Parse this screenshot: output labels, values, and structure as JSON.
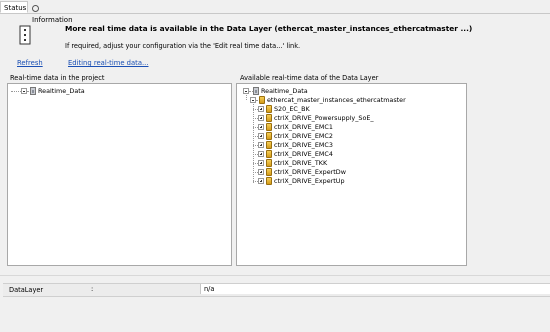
{
  "tabs": [
    {
      "label": "Status",
      "active": true
    },
    {
      "label": "Information",
      "active": false,
      "icon": "info-circle-icon"
    }
  ],
  "notice": {
    "icon": "device-icon",
    "title": "More real time data is available in the Data Layer (ethercat_master_instances_ethercatmaster ...)",
    "subtitle": "If required, adjust your configuration via the 'Edit real time data...' link."
  },
  "actions": {
    "refresh_label": "Refresh",
    "edit_label": "Editing real-time data..."
  },
  "left_pane": {
    "label": "Real-time data in the project",
    "tree": [
      {
        "label": "Realtime_Data",
        "icon": "database-icon",
        "expander": "minus"
      }
    ]
  },
  "right_pane": {
    "label": "Available real-time data of the Data Layer",
    "root": {
      "label": "Realtime_Data",
      "icon": "database-icon",
      "expander": "minus"
    },
    "instance": {
      "label": "ethercat_master_instances_ethercatmaster",
      "icon": "folder-node-icon",
      "expander": "minus"
    },
    "children": [
      {
        "label": "S20_EC_BK",
        "icon": "folder-node-icon",
        "expander": "plus"
      },
      {
        "label": "ctrlX_DRIVE_Powersupply_SoE_",
        "icon": "folder-node-icon",
        "expander": "plus"
      },
      {
        "label": "ctrlX_DRIVE_EMC1",
        "icon": "folder-node-icon",
        "expander": "plus"
      },
      {
        "label": "ctrlX_DRIVE_EMC2",
        "icon": "folder-node-icon",
        "expander": "plus"
      },
      {
        "label": "ctrlX_DRIVE_EMC3",
        "icon": "folder-node-icon",
        "expander": "plus"
      },
      {
        "label": "ctrlX_DRIVE_EMC4",
        "icon": "folder-node-icon",
        "expander": "plus"
      },
      {
        "label": "ctrlX_DRIVE_TKK",
        "icon": "folder-node-icon",
        "expander": "plus"
      },
      {
        "label": "ctrlX_DRIVE_ExpertDw",
        "icon": "folder-node-icon",
        "expander": "plus"
      },
      {
        "label": "ctrlX_DRIVE_ExpertUp",
        "icon": "folder-node-icon",
        "expander": "plus"
      }
    ]
  },
  "properties": {
    "name": "DataLayer",
    "separator": ":",
    "value": "n/a"
  },
  "colors": {
    "link": "#1a4fb4",
    "background": "#f0f0f0",
    "pane_background": "#ffffff",
    "node_icon": "#e2b030"
  }
}
